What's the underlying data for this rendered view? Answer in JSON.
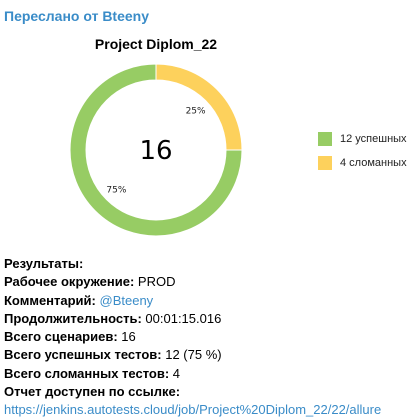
{
  "forwarded_from": "Переслано от Bteeny",
  "chart_data": {
    "type": "pie",
    "title": "Project Diplom_22",
    "center_label": "16",
    "slices": [
      {
        "name": "12 успешных",
        "value": 12,
        "percent_label": "75%",
        "color": "#97cc64"
      },
      {
        "name": "4 сломанных",
        "value": 4,
        "percent_label": "25%",
        "color": "#fdd15c"
      }
    ],
    "legend_position": "right"
  },
  "results": {
    "heading": "Результаты:",
    "environment_label": "Рабочее окружение:",
    "environment_value": "PROD",
    "comment_label": "Комментарий:",
    "comment_value": "@Bteeny",
    "duration_label": "Продолжительность:",
    "duration_value": "00:01:15.016",
    "scenarios_label": "Всего сценариев:",
    "scenarios_value": "16",
    "passed_label": "Всего успешных тестов:",
    "passed_value": "12 (75 %)",
    "broken_label": "Всего сломанных тестов:",
    "broken_value": "4",
    "report_label": "Отчет доступен по ссылке:",
    "report_link": "https://jenkins.autotests.cloud/job/Project%20Diplom_22/22/allure"
  }
}
